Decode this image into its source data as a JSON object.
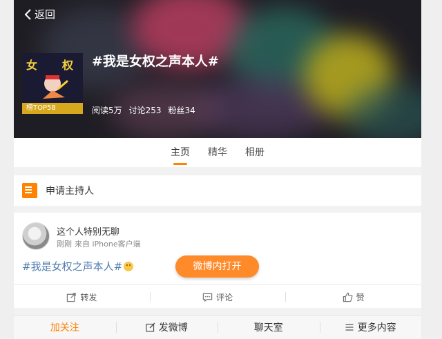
{
  "header": {
    "back_label": "返回",
    "title": "#我是女权之声本人#",
    "cover_chars": [
      "女",
      "权"
    ],
    "rank_badge": "榜TOP58",
    "stats": [
      "阅读5万",
      "讨论253",
      "粉丝34"
    ]
  },
  "tabs": [
    {
      "label": "主页",
      "active": true
    },
    {
      "label": "精华",
      "active": false
    },
    {
      "label": "相册",
      "active": false
    }
  ],
  "host": {
    "label": "申请主持人",
    "icon": "host-list-icon"
  },
  "post": {
    "username": "这个人特别无聊",
    "time": "刚刚",
    "source": "来自 iPhone客户端",
    "content": "#我是女权之声本人#",
    "open_button": "微博内打开",
    "actions": [
      {
        "label": "转发",
        "icon": "share-icon"
      },
      {
        "label": "评论",
        "icon": "comment-icon"
      },
      {
        "label": "赞",
        "icon": "thumb-up-icon"
      }
    ]
  },
  "bottom_bar": [
    {
      "label": "加关注"
    },
    {
      "label": "发微博",
      "icon": "compose-icon"
    },
    {
      "label": "聊天室"
    },
    {
      "label": "更多内容",
      "icon": "menu-icon"
    }
  ],
  "colors": {
    "accent": "#ff8200",
    "link": "#507daf"
  }
}
